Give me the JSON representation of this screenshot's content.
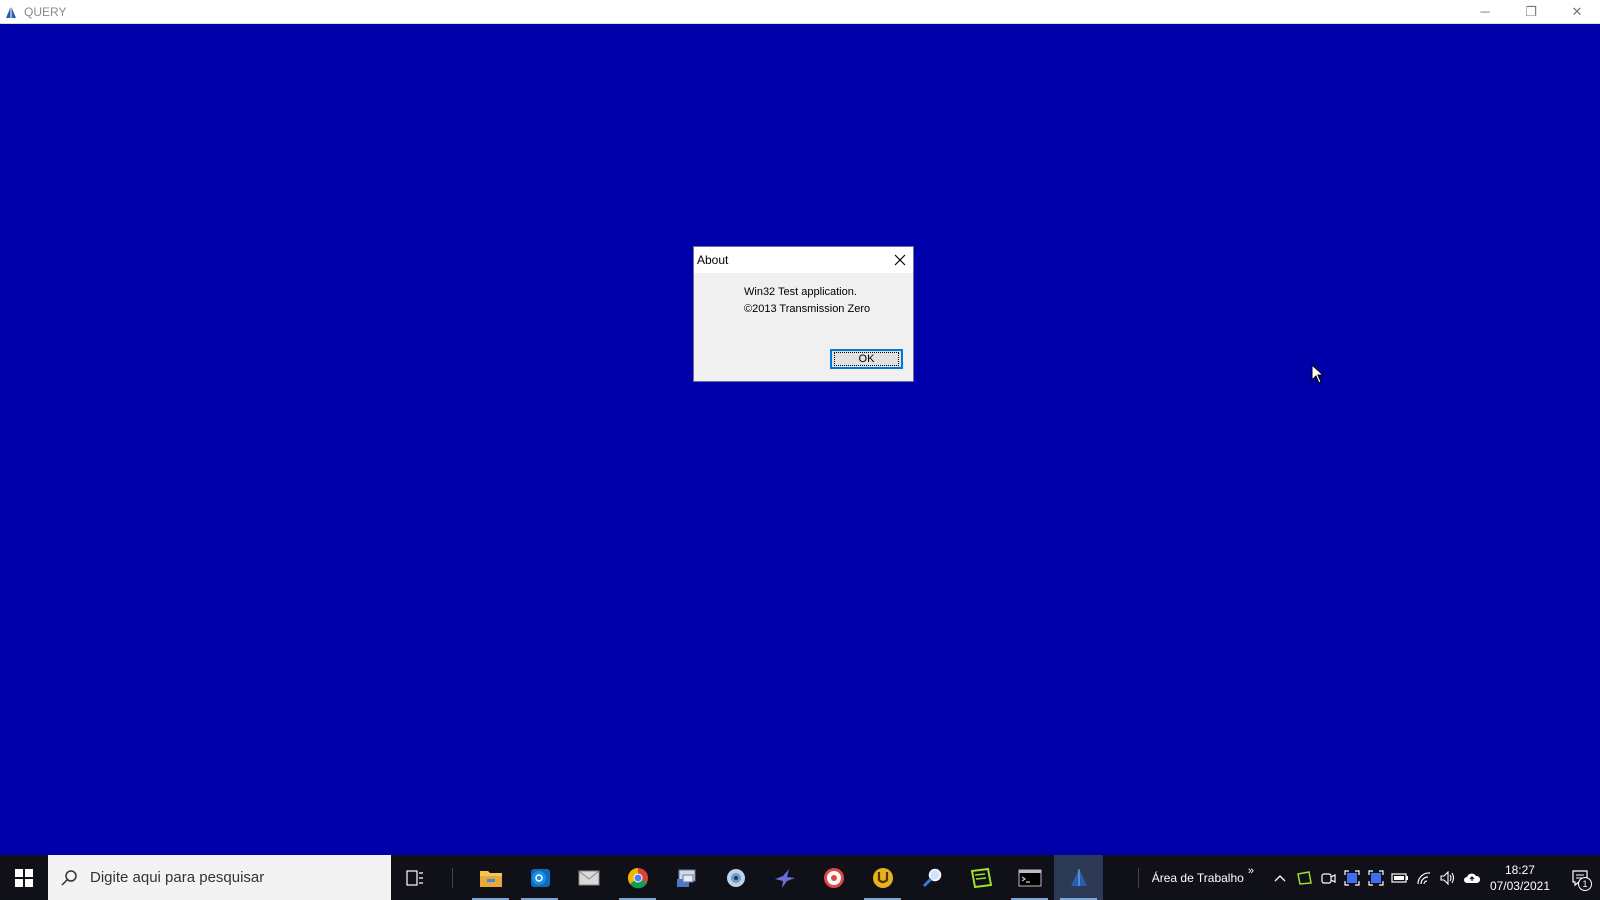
{
  "window": {
    "title": "QUERY",
    "controls": {
      "minimize": "─",
      "restore": "❐",
      "close": "✕"
    }
  },
  "dialog": {
    "title": "About",
    "line1": "Win32 Test application.",
    "line2": "©2013 Transmission Zero",
    "ok_label": "OK"
  },
  "taskbar": {
    "search_placeholder": "Digite aqui para pesquisar",
    "apps": [
      "file-explorer-icon",
      "outlook-icon",
      "mail-icon",
      "chrome-icon",
      "network-icon",
      "webcam-icon",
      "bird-app-icon",
      "disc-icon",
      "utility-icon",
      "magnifier-icon",
      "snip-icon",
      "cmd-icon",
      "query-app-icon"
    ],
    "toolbar_label": "Área de Trabalho",
    "toolbar_chevron": "»",
    "clock_time": "18:27",
    "clock_date": "07/03/2021",
    "notification_count": "1"
  },
  "colors": {
    "desktop": "#0000aa",
    "taskbar": "#101018",
    "accent": "#0078d7"
  }
}
